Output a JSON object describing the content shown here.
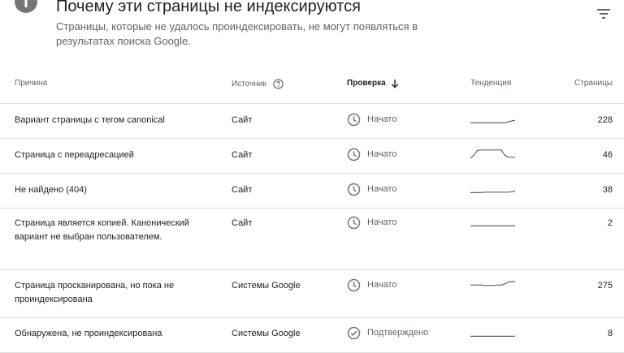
{
  "header": {
    "title": "Почему эти страницы не индексируются",
    "subtitle": "Страницы, которые не удалось проиндексировать, не могут появляться в результатах поиска Google.",
    "info_icon": "info-icon",
    "filter_icon": "filter-icon"
  },
  "table": {
    "columns": {
      "reason": "Причина",
      "source": "Источник",
      "check": "Проверка",
      "trend": "Тенденция",
      "pages": "Страницы"
    },
    "rows": [
      {
        "reason": "Вариант страницы с тегом canonical",
        "source": "Сайт",
        "status": "Начато",
        "status_icon": "clock-icon",
        "pages": "228",
        "trend": [
          0.05,
          0.05,
          0.05,
          0.05,
          0.05,
          0.05,
          0.05,
          0.05,
          0.05,
          0.05,
          0.05,
          0.15,
          0.25,
          0.3
        ]
      },
      {
        "reason": "Страница с переадресацией",
        "source": "Сайт",
        "status": "Начато",
        "status_icon": "clock-icon",
        "pages": "46",
        "trend": [
          0.0,
          0.3,
          0.8,
          0.85,
          0.85,
          0.85,
          0.85,
          0.85,
          0.85,
          0.85,
          0.3,
          0.1,
          0.1,
          0.1
        ]
      },
      {
        "reason": "Не найдено (404)",
        "source": "Сайт",
        "status": "Начато",
        "status_icon": "clock-icon",
        "pages": "38",
        "trend": [
          0.05,
          0.05,
          0.05,
          0.05,
          0.1,
          0.1,
          0.1,
          0.1,
          0.1,
          0.1,
          0.1,
          0.1,
          0.15,
          0.2
        ]
      },
      {
        "reason": "Страница является копией. Канонический вариант не выбран пользователем.",
        "source": "Сайт",
        "status": "Начато",
        "status_icon": "clock-icon",
        "pages": "2",
        "trend": [
          0.05,
          0.05,
          0.05,
          0.05,
          0.05,
          0.05,
          0.05,
          0.05,
          0.05,
          0.05,
          0.05,
          0.05,
          0.05,
          0.05
        ]
      },
      {
        "reason": "Страница просканирована, но пока не проиндексирована",
        "source": "Системы Google",
        "status": "Начато",
        "status_icon": "clock-icon",
        "pages": "275",
        "trend": [
          0.4,
          0.4,
          0.4,
          0.4,
          0.35,
          0.35,
          0.35,
          0.35,
          0.4,
          0.4,
          0.5,
          0.7,
          0.75,
          0.75
        ]
      },
      {
        "reason": "Обнаружена, не проиндексирована",
        "source": "Системы Google",
        "status": "Подтверждено",
        "status_icon": "check-circle-icon",
        "pages": "8",
        "trend": [
          0.05,
          0.05,
          0.05,
          0.05,
          0.05,
          0.05,
          0.05,
          0.05,
          0.05,
          0.05,
          0.05,
          0.05,
          0.05,
          0.05
        ]
      }
    ]
  },
  "colors": {
    "text": "#202124",
    "secondary": "#5f6368",
    "icon": "#757575",
    "divider": "#e0e0e0",
    "sparkline": "#616161"
  }
}
